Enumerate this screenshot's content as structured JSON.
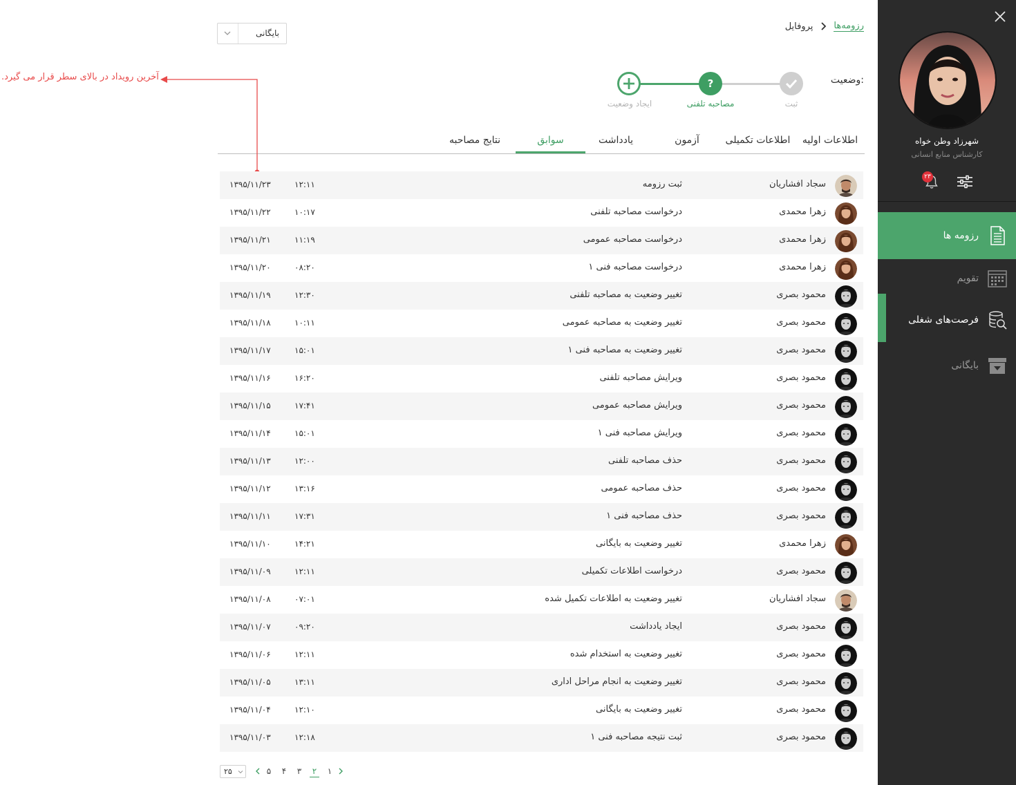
{
  "sidebar": {
    "profile": {
      "name": "شهرزاد  وطن خواه",
      "role": "کارشناس منابع انسانی"
    },
    "notification_count": "۲۳",
    "nav": {
      "resumes": "رزومه ها",
      "calendar": "تقویم",
      "jobs": "فرصت‌های شغلی",
      "archive": "بایگانی"
    },
    "icons": [
      "close-icon",
      "filter-sliders-icon",
      "bell-icon",
      "document-icon",
      "calendar-icon",
      "jobs-search-icon",
      "archive-box-icon"
    ],
    "colors": {
      "background": "#2b2b2b",
      "active": "#4ca56c"
    }
  },
  "breadcrumb": {
    "link": "رزومه‌ها",
    "current": "پروفایل"
  },
  "archive_select": {
    "label": "بایگانی"
  },
  "status": {
    "label": "وضعیت:",
    "steps": [
      {
        "label": "ثبت",
        "state": "done"
      },
      {
        "label": "مصاحبه تلفنی",
        "state": "current",
        "symbol": "?"
      },
      {
        "label": "ایجاد وضعیت",
        "state": "add"
      }
    ]
  },
  "tabs": [
    {
      "label": "اطلاعات اولیه",
      "active": false
    },
    {
      "label": "اطلاعات تکمیلی",
      "active": false
    },
    {
      "label": "آزمون",
      "active": false
    },
    {
      "label": "یادداشت",
      "active": false
    },
    {
      "label": "سوابق",
      "active": true
    },
    {
      "label": "نتایج مصاحبه",
      "active": false
    }
  ],
  "annotation": "آخرین رویداد در بالای سطر قرار می گیرد.",
  "history": [
    {
      "user": "سجاد افشاریان",
      "event": "ثبت رزومه",
      "time": "۱۲:۱۱",
      "date": "۱۳۹۵/۱۱/۲۳",
      "avatar": "sajad"
    },
    {
      "user": "زهرا محمدی",
      "event": "درخواست مصاحبه تلفنی",
      "time": "۱۰:۱۷",
      "date": "۱۳۹۵/۱۱/۲۲",
      "avatar": "zahra"
    },
    {
      "user": "زهرا محمدی",
      "event": "درخواست مصاحبه عمومی",
      "time": "۱۱:۱۹",
      "date": "۱۳۹۵/۱۱/۲۱",
      "avatar": "zahra"
    },
    {
      "user": "زهرا محمدی",
      "event": "درخواست مصاحبه فنی ۱",
      "time": "۰۸:۲۰",
      "date": "۱۳۹۵/۱۱/۲۰",
      "avatar": "zahra"
    },
    {
      "user": "محمود بصری",
      "event": "تغییر وضعیت به مصاحبه تلفنی",
      "time": "۱۲:۳۰",
      "date": "۱۳۹۵/۱۱/۱۹",
      "avatar": "mahmoud"
    },
    {
      "user": "محمود بصری",
      "event": "تغییر وضعیت به مصاحبه عمومی",
      "time": "۱۰:۱۱",
      "date": "۱۳۹۵/۱۱/۱۸",
      "avatar": "mahmoud"
    },
    {
      "user": "محمود بصری",
      "event": "تغییر وضعیت به مصاحبه فنی ۱",
      "time": "۱۵:۰۱",
      "date": "۱۳۹۵/۱۱/۱۷",
      "avatar": "mahmoud"
    },
    {
      "user": "محمود بصری",
      "event": "ویرایش مصاحبه تلفنی",
      "time": "۱۶:۲۰",
      "date": "۱۳۹۵/۱۱/۱۶",
      "avatar": "mahmoud"
    },
    {
      "user": "محمود بصری",
      "event": "ویرایش مصاحبه عمومی",
      "time": "۱۷:۴۱",
      "date": "۱۳۹۵/۱۱/۱۵",
      "avatar": "mahmoud"
    },
    {
      "user": "محمود بصری",
      "event": "ویرایش مصاحبه فنی ۱",
      "time": "۱۵:۰۱",
      "date": "۱۳۹۵/۱۱/۱۴",
      "avatar": "mahmoud"
    },
    {
      "user": "محمود بصری",
      "event": "حذف مصاحبه تلفنی",
      "time": "۱۲:۰۰",
      "date": "۱۳۹۵/۱۱/۱۳",
      "avatar": "mahmoud"
    },
    {
      "user": "محمود بصری",
      "event": "حذف مصاحبه عمومی",
      "time": "۱۳:۱۶",
      "date": "۱۳۹۵/۱۱/۱۲",
      "avatar": "mahmoud"
    },
    {
      "user": "محمود بصری",
      "event": "حذف مصاحبه فنی ۱",
      "time": "۱۷:۳۱",
      "date": "۱۳۹۵/۱۱/۱۱",
      "avatar": "mahmoud"
    },
    {
      "user": "زهرا محمدی",
      "event": "تغییر وضعیت به بایگانی",
      "time": "۱۴:۲۱",
      "date": "۱۳۹۵/۱۱/۱۰",
      "avatar": "zahra"
    },
    {
      "user": "محمود بصری",
      "event": "درخواست اطلاعات تکمیلی",
      "time": "۱۲:۱۱",
      "date": "۱۳۹۵/۱۱/۰۹",
      "avatar": "mahmoud"
    },
    {
      "user": "سجاد افشاریان",
      "event": "تغییر وضعیت به اطلاعات تکمیل شده",
      "time": "۰۷:۰۱",
      "date": "۱۳۹۵/۱۱/۰۸",
      "avatar": "sajad"
    },
    {
      "user": "محمود بصری",
      "event": "ایجاد یادداشت",
      "time": "۰۹:۲۰",
      "date": "۱۳۹۵/۱۱/۰۷",
      "avatar": "mahmoud"
    },
    {
      "user": "محمود بصری",
      "event": "تغییر وضعیت به استخدام شده",
      "time": "۱۲:۱۱",
      "date": "۱۳۹۵/۱۱/۰۶",
      "avatar": "mahmoud"
    },
    {
      "user": "محمود بصری",
      "event": "تغییر وضعیت به انجام مراحل اداری",
      "time": "۱۳:۱۱",
      "date": "۱۳۹۵/۱۱/۰۵",
      "avatar": "mahmoud"
    },
    {
      "user": "محمود بصری",
      "event": "تغییر وضعیت به بایگانی",
      "time": "۱۲:۱۰",
      "date": "۱۳۹۵/۱۱/۰۴",
      "avatar": "mahmoud"
    },
    {
      "user": "محمود بصری",
      "event": "ثبت نتیجه مصاحبه فنی ۱",
      "time": "۱۲:۱۸",
      "date": "۱۳۹۵/۱۱/۰۳",
      "avatar": "mahmoud"
    }
  ],
  "pagination": {
    "page_size": "۲۵",
    "pages": [
      "۱",
      "۲",
      "۳",
      "۴",
      "۵"
    ],
    "active_page": "۲"
  },
  "colors": {
    "accent": "#4ca56c",
    "annotation": "#e84a4a"
  }
}
